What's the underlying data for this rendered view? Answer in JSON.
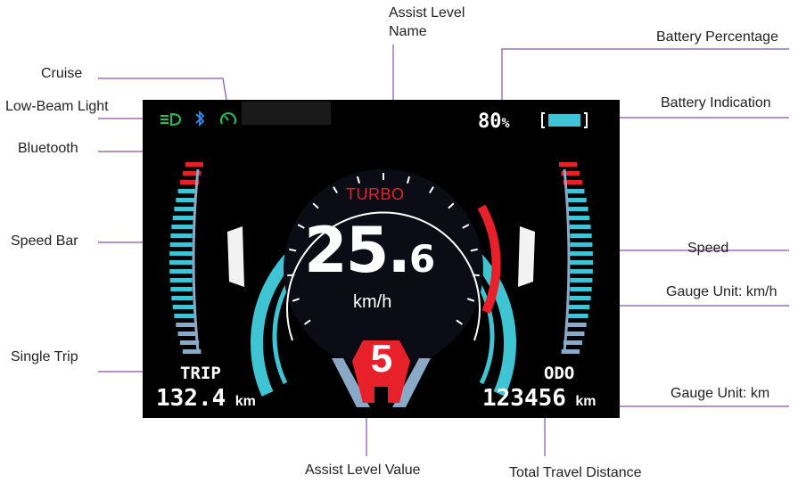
{
  "display": {
    "assist_name": "TURBO",
    "speed_whole": "25.",
    "speed_decimal": "6",
    "speed_unit": "km/h",
    "assist_level": "5",
    "battery_percent": "80",
    "battery_percent_sign": "%",
    "trip_label": "TRIP",
    "trip_value": "132.4",
    "trip_unit": "km",
    "odo_label": "ODO",
    "odo_value": "123456",
    "odo_unit": "km"
  },
  "indicators": {
    "low_beam_icon": "low-beam-light-icon",
    "bluetooth_icon": "bluetooth-icon",
    "cruise_icon": "cruise-icon"
  },
  "callouts": {
    "assist_level_name": "Assist Level Name",
    "assist_level_name_line1": "Assist Level",
    "assist_level_name_line2": "Name",
    "battery_percentage": "Battery Percentage",
    "battery_indication": "Battery Indication",
    "cruise": "Cruise",
    "low_beam": "Low-Beam Light",
    "bluetooth": "Bluetooth",
    "speed_bar": "Speed Bar",
    "speed": "Speed",
    "gauge_unit_kmh": "Gauge Unit: km/h",
    "single_trip": "Single Trip",
    "gauge_unit_km": "Gauge Unit: km",
    "assist_level_value": "Assist Level Value",
    "total_travel_distance": "Total Travel Distance"
  },
  "colors": {
    "cyan": "#3fc4d4",
    "red": "#e8202a",
    "green": "#22c25a",
    "blue": "#2e8ef0",
    "background": "#000000",
    "callout_line": "#8a4fa8"
  }
}
